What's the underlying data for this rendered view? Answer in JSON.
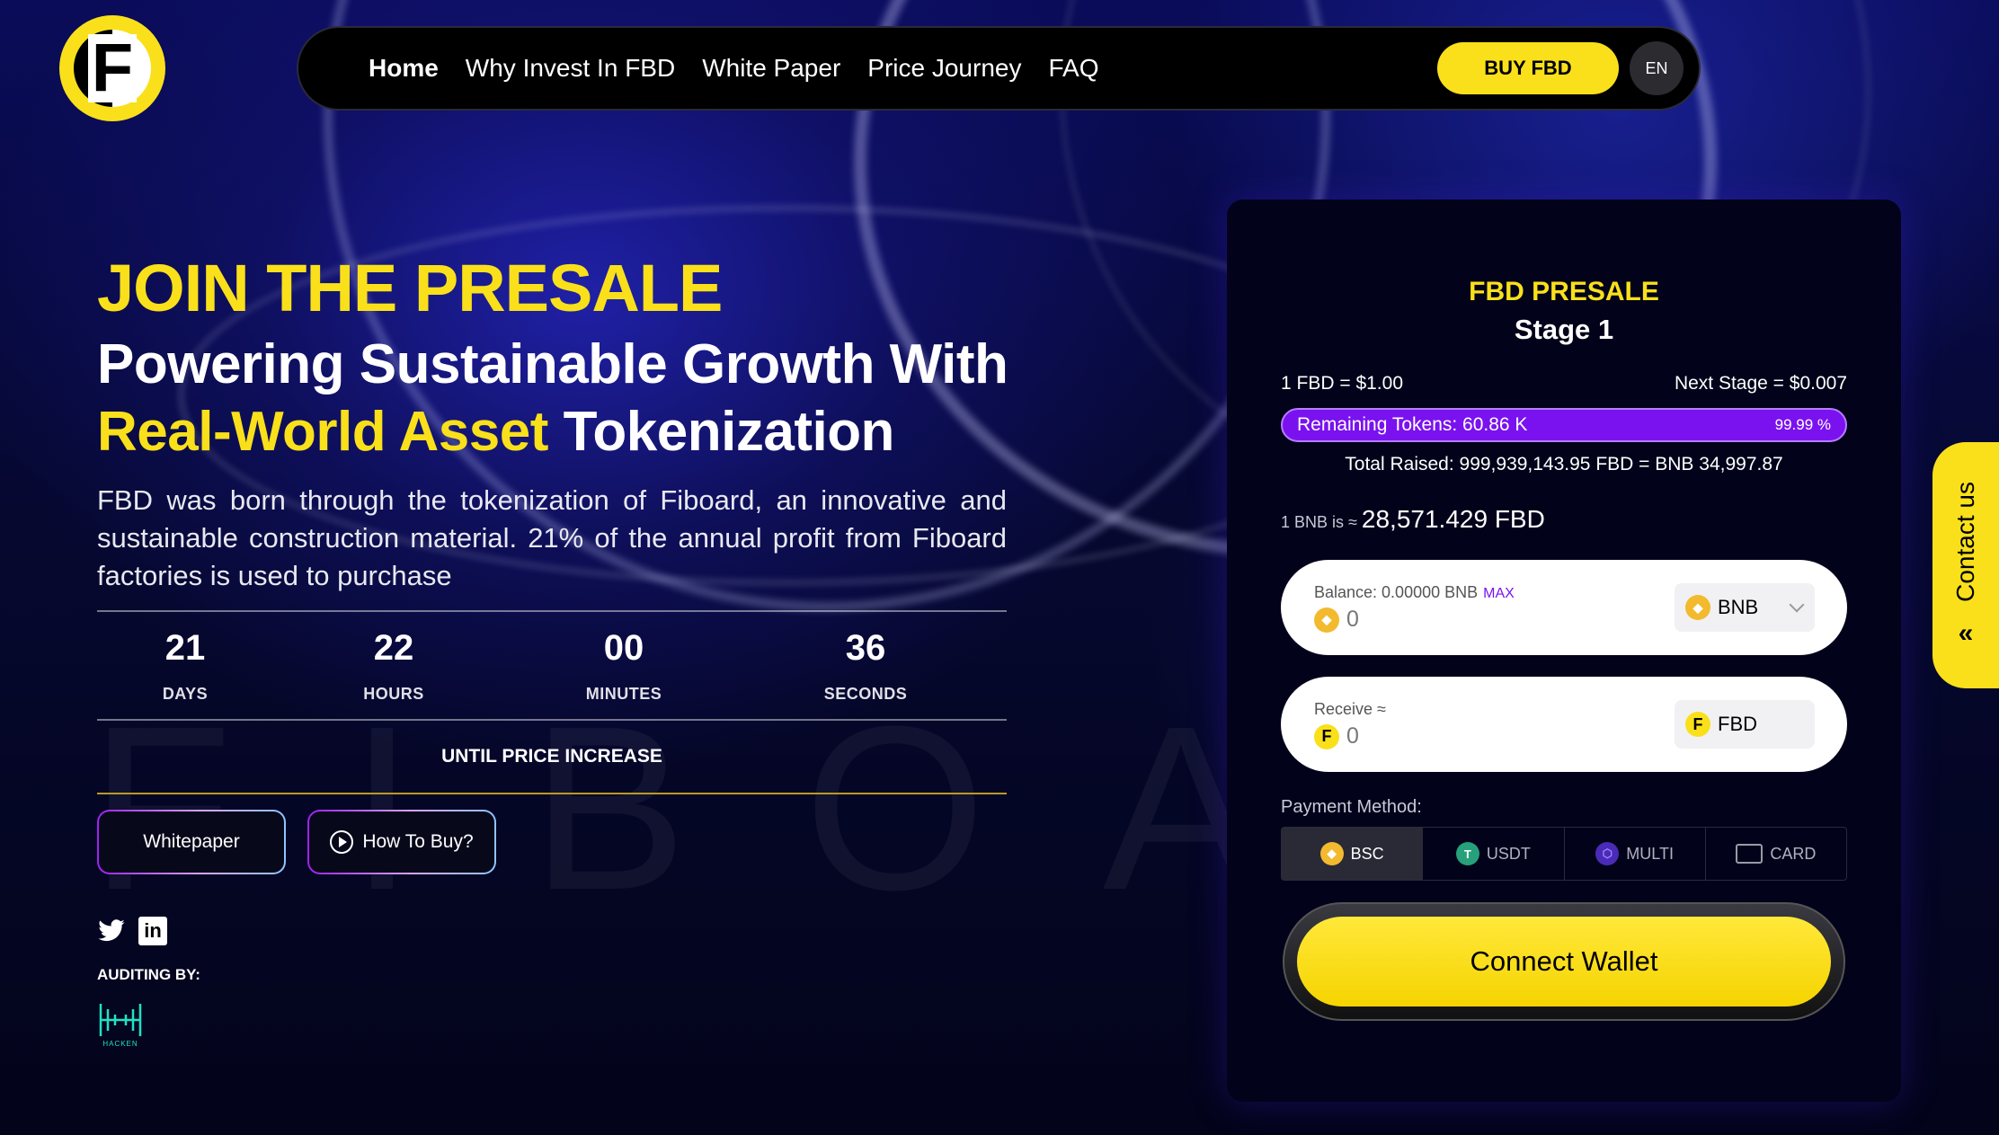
{
  "brand": {
    "logo_letter": "F",
    "accent": "#f9e01a",
    "purple": "#7a12ef"
  },
  "nav": {
    "links": [
      "Home",
      "Why Invest In FBD",
      "White Paper",
      "Price Journey",
      "FAQ"
    ],
    "buy_label": "BUY FBD",
    "lang": "EN"
  },
  "hero": {
    "kicker": "JOIN THE PRESALE",
    "title_line1": "Powering Sustainable Growth With",
    "title_highlight": "Real-World Asset",
    "title_tail": " Tokenization",
    "description": "FBD was born through the tokenization of Fiboard, an innovative and sustainable construction material. 21% of the annual profit from Fiboard factories is used to purchase",
    "bg_word": "FIBOARD"
  },
  "countdown": {
    "units": [
      {
        "value": "21",
        "label": "DAYS"
      },
      {
        "value": "22",
        "label": "HOURS"
      },
      {
        "value": "00",
        "label": "MINUTES"
      },
      {
        "value": "36",
        "label": "SECONDS"
      }
    ],
    "until": "UNTIL PRICE INCREASE"
  },
  "buttons": {
    "whitepaper": "Whitepaper",
    "how_to_buy": "How To Buy?"
  },
  "auditing": {
    "label": "AUDITING BY:",
    "auditor": "HACKEN"
  },
  "presale": {
    "title": "FBD PRESALE",
    "stage": "Stage 1",
    "price": "1 FBD = $1.00",
    "next_stage": "Next Stage = $0.007",
    "remaining": "Remaining Tokens: 60.86 K",
    "percent": "99.99 %",
    "progress_fraction": 0.9999,
    "total_raised": "Total Raised: 999,939,143.95 FBD = BNB 34,997.87",
    "rate_prefix": "1 BNB is ≈ ",
    "rate_value": "28,571.429 FBD",
    "pay": {
      "balance_label": "Balance: 0.00000 BNB",
      "max": "MAX",
      "value": "0",
      "token": "BNB"
    },
    "receive": {
      "label": "Receive ≈",
      "value": "0",
      "token": "FBD"
    },
    "payment_method_label": "Payment Method:",
    "methods": [
      "BSC",
      "USDT",
      "MULTI",
      "CARD"
    ],
    "active_method": "BSC",
    "connect": "Connect Wallet"
  },
  "contact": {
    "label": "Contact us"
  }
}
